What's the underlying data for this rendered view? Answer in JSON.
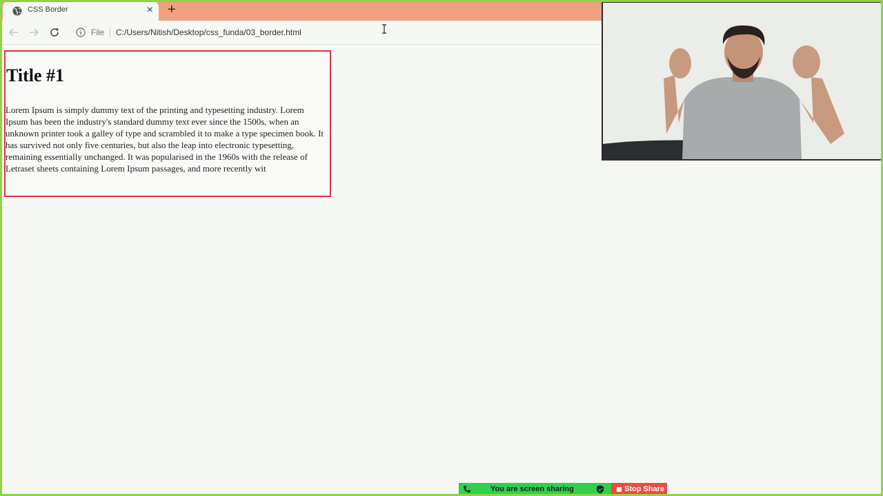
{
  "browser": {
    "tab": {
      "title": "CSS Border",
      "close": "×"
    },
    "new_tab": "+",
    "omnibox": {
      "scheme_label": "File",
      "url": "C:/Users/Nitish/Desktop/css_funda/03_border.html"
    }
  },
  "page": {
    "title": "Title #1",
    "paragraph": "Lorem Ipsum is simply dummy text of the printing and typesetting industry. Lorem Ipsum has been the industry's standard dummy text ever since the 1500s, when an unknown printer took a galley of type and scrambled it to make a type specimen book. It has survived not only five centuries, but also the leap into electronic typesetting, remaining essentially unchanged. It was popularised in the 1960s with the release of Letraset sheets containing Lorem Ipsum passages, and more recently wit",
    "border_color": "#e0303e"
  },
  "screen_share": {
    "status": "You are screen sharing",
    "stop_label": "Stop Share"
  },
  "colors": {
    "tabstrip": "#f0a180",
    "share_green": "#2fcf4f",
    "stop_red": "#ee4a3f",
    "frame_green": "#8fd444"
  }
}
